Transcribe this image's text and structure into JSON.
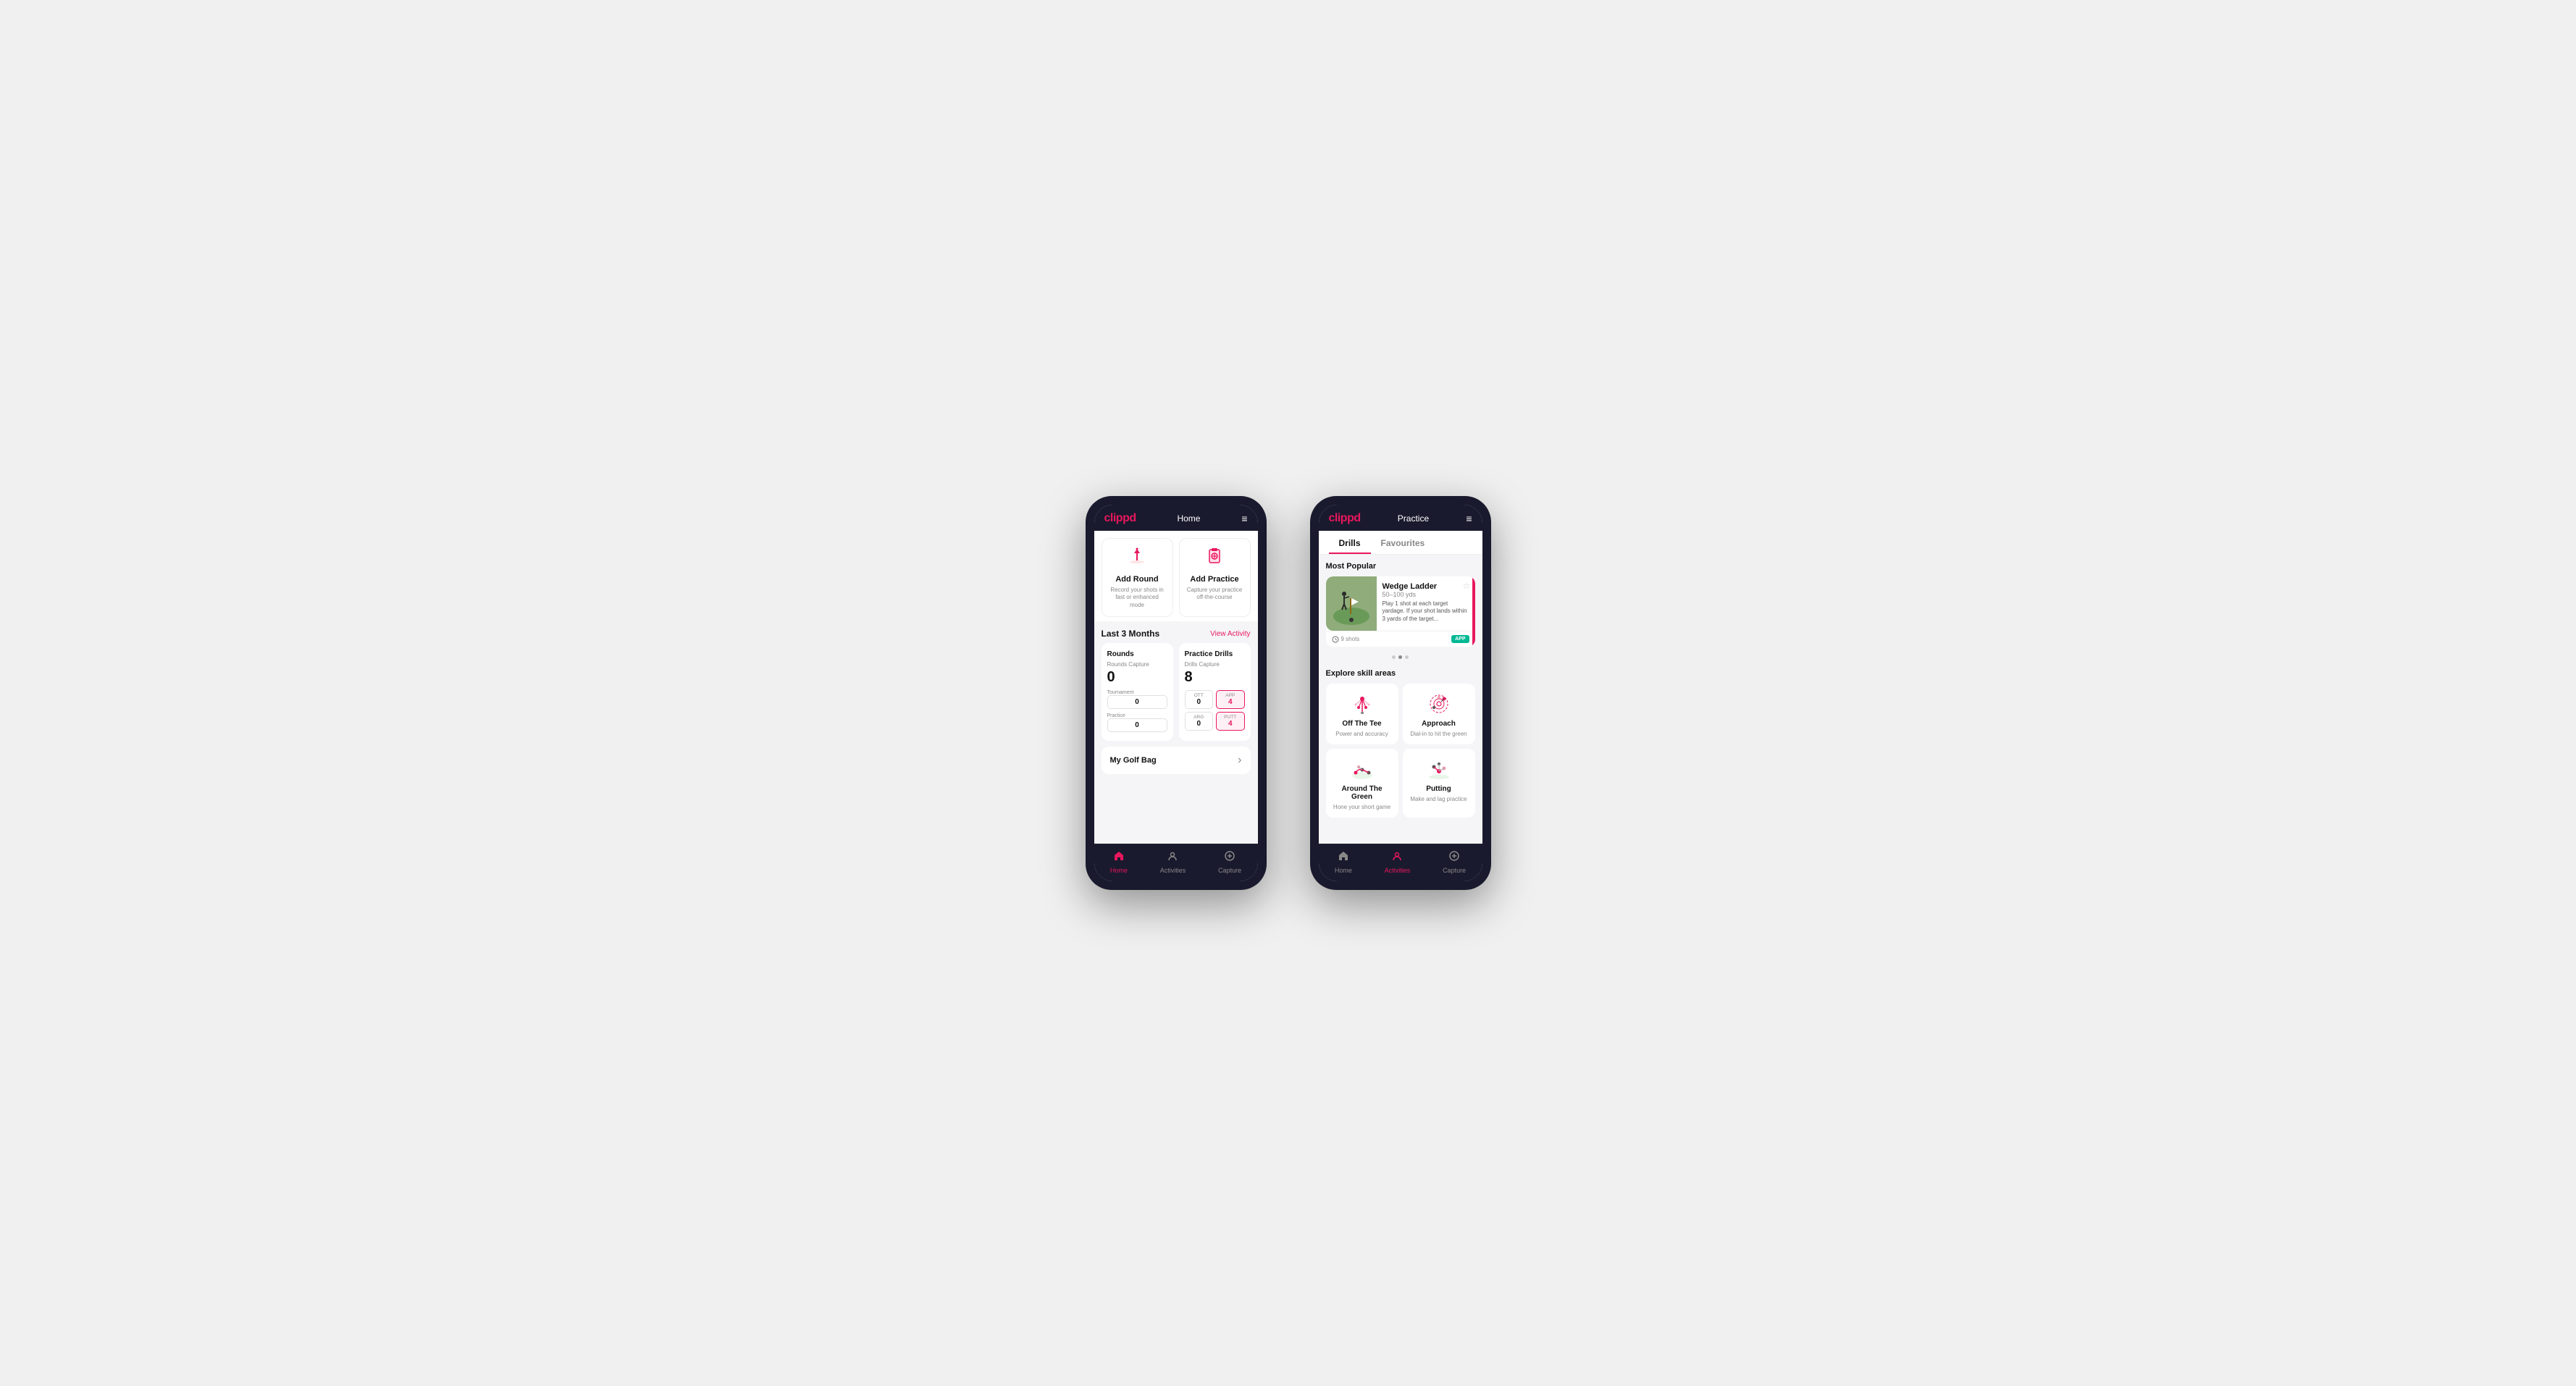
{
  "phone1": {
    "header": {
      "logo": "clippd",
      "title": "Home",
      "menu_icon": "≡"
    },
    "action_cards": [
      {
        "id": "add-round",
        "icon": "⛳",
        "title": "Add Round",
        "description": "Record your shots in fast or enhanced mode"
      },
      {
        "id": "add-practice",
        "icon": "📋",
        "title": "Add Practice",
        "description": "Capture your practice off-the-course"
      }
    ],
    "activity_section": {
      "title": "Last 3 Months",
      "link": "View Activity"
    },
    "stats": {
      "rounds": {
        "title": "Rounds",
        "capture_label": "Rounds Capture",
        "total": "0",
        "rows": [
          {
            "label": "Tournament",
            "value": "0"
          },
          {
            "label": "Practice",
            "value": "0"
          }
        ]
      },
      "practice_drills": {
        "title": "Practice Drills",
        "capture_label": "Drills Capture",
        "total": "8",
        "rows": [
          {
            "items": [
              {
                "label": "OTT",
                "value": "0",
                "highlighted": false
              },
              {
                "label": "APP",
                "value": "4",
                "highlighted": true
              }
            ]
          },
          {
            "items": [
              {
                "label": "ARG",
                "value": "0",
                "highlighted": false
              },
              {
                "label": "PUTT",
                "value": "4",
                "highlighted": true
              }
            ]
          }
        ]
      }
    },
    "golf_bag": {
      "label": "My Golf Bag",
      "chevron": "›"
    },
    "bottom_nav": [
      {
        "icon": "⊙",
        "label": "Home",
        "active": true
      },
      {
        "icon": "♟",
        "label": "Activities",
        "active": false
      },
      {
        "icon": "⊕",
        "label": "Capture",
        "active": false
      }
    ]
  },
  "phone2": {
    "header": {
      "logo": "clippd",
      "title": "Practice",
      "menu_icon": "≡"
    },
    "tabs": [
      {
        "label": "Drills",
        "active": true
      },
      {
        "label": "Favourites",
        "active": false
      }
    ],
    "most_popular": {
      "title": "Most Popular",
      "card": {
        "title": "Wedge Ladder",
        "subtitle": "50–100 yds",
        "description": "Play 1 shot at each target yardage. If your shot lands within 3 yards of the target...",
        "shots": "9 shots",
        "badge": "APP"
      }
    },
    "dots": [
      {
        "active": false
      },
      {
        "active": true
      },
      {
        "active": false
      }
    ],
    "explore": {
      "title": "Explore skill areas",
      "skills": [
        {
          "id": "off-the-tee",
          "title": "Off The Tee",
          "description": "Power and accuracy"
        },
        {
          "id": "approach",
          "title": "Approach",
          "description": "Dial-in to hit the green"
        },
        {
          "id": "around-the-green",
          "title": "Around The Green",
          "description": "Hone your short game"
        },
        {
          "id": "putting",
          "title": "Putting",
          "description": "Make and lag practice"
        }
      ]
    },
    "bottom_nav": [
      {
        "icon": "⊙",
        "label": "Home",
        "active": false
      },
      {
        "icon": "♟",
        "label": "Activities",
        "active": true
      },
      {
        "icon": "⊕",
        "label": "Capture",
        "active": false
      }
    ]
  }
}
